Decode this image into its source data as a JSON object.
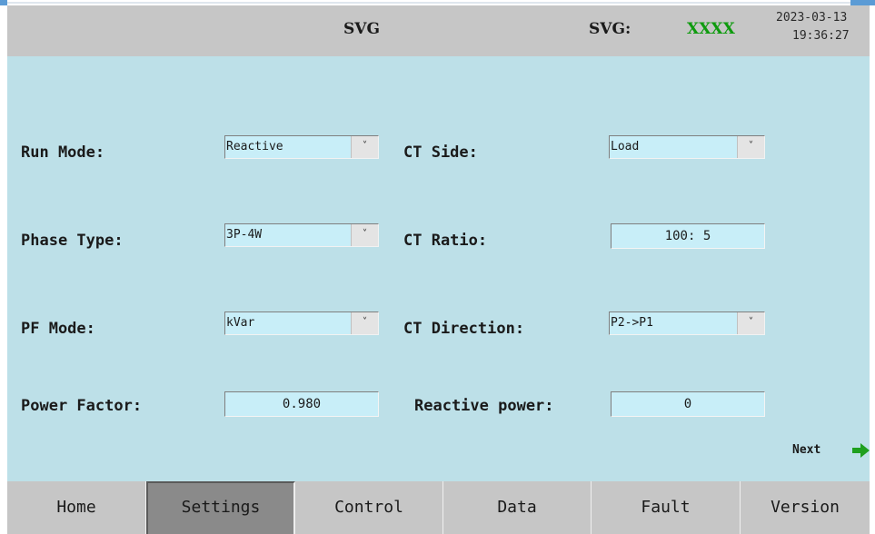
{
  "header": {
    "title": "SVG",
    "device_label": "SVG:",
    "device_value": "XXXX",
    "date": "2023-03-13",
    "time": "19:36:27"
  },
  "settings": {
    "run_mode": {
      "label": "Run Mode:",
      "value": "Reactive"
    },
    "phase_type": {
      "label": "Phase Type:",
      "value": "3P-4W"
    },
    "pf_mode": {
      "label": "PF Mode:",
      "value": "kVar"
    },
    "power_factor": {
      "label": "Power Factor:",
      "value": "0.980"
    },
    "ct_side": {
      "label": "CT Side:",
      "value": "Load"
    },
    "ct_ratio": {
      "label": "CT Ratio:",
      "value": "100: 5"
    },
    "ct_direction": {
      "label": "CT Direction:",
      "value": "P2->P1"
    },
    "reactive_power": {
      "label": "Reactive power:",
      "value": "0"
    }
  },
  "dropdown_arrow": "˅",
  "next_label": "Next",
  "tabs": [
    "Home",
    "Settings",
    "Control",
    "Data",
    "Fault",
    "Version"
  ],
  "active_tab": "Settings",
  "colors": {
    "background": "#bde0e8",
    "header": "#c6c6c6",
    "field": "#c8eef8",
    "device_value": "#0e9b0e",
    "next_arrow": "#1fa01f",
    "active_tab": "#8a8a8a"
  },
  "icons": {
    "next": "arrow-right-icon",
    "dropdown": "chevron-down-icon"
  }
}
